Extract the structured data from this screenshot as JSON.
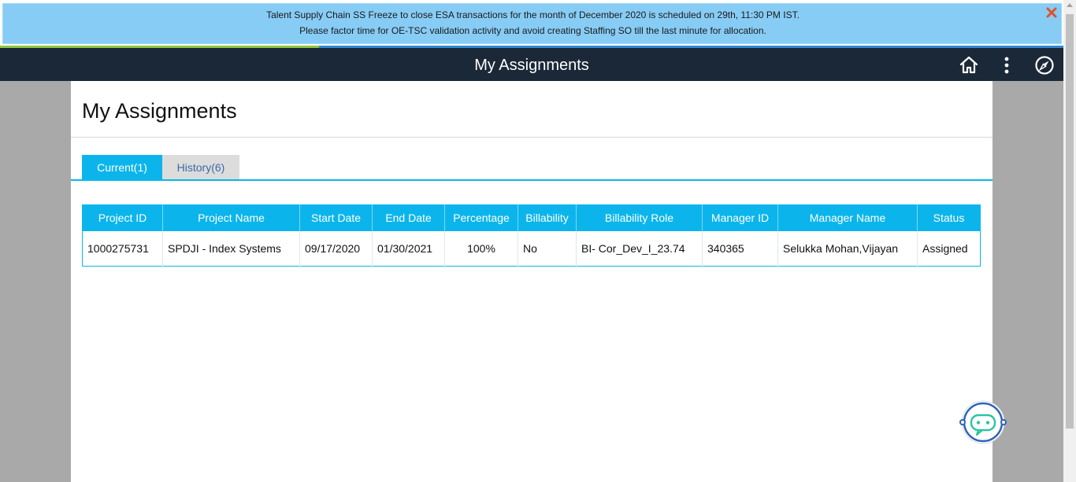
{
  "banner": {
    "line1": "Talent Supply Chain SS Freeze to close ESA transactions for the month of December 2020 is scheduled on 29th, 11:30 PM IST.",
    "line2": "Please factor time for OE-TSC validation activity and avoid creating Staffing SO till the last minute for allocation.",
    "close_icon": "close-x-icon",
    "close_color": "#e0522c"
  },
  "header": {
    "title": "My Assignments",
    "icons": [
      "home-icon",
      "more-vertical-icon",
      "navigator-compass-icon"
    ]
  },
  "page": {
    "title": "My Assignments"
  },
  "tabs": [
    {
      "label": "Current(1)",
      "active": true
    },
    {
      "label": "History(6)",
      "active": false
    }
  ],
  "table": {
    "columns": [
      "Project ID",
      "Project Name",
      "Start Date",
      "End Date",
      "Percentage",
      "Billability",
      "Billability Role",
      "Manager ID",
      "Manager Name",
      "Status"
    ],
    "rows": [
      [
        "1000275731",
        "SPDJI - Index Systems",
        "09/17/2020",
        "01/30/2021",
        "100%",
        "No",
        "BI- Cor_Dev_I_23.74",
        "340365",
        "Selukka Mohan,Vijayan",
        "Assigned"
      ]
    ]
  },
  "chatbot": {
    "icon": "chatbot-icon"
  },
  "colors": {
    "accent": "#0bb5ec",
    "header_bg": "#1b2837",
    "banner_bg": "#87ccf5",
    "backdrop": "#a9a9a9"
  }
}
